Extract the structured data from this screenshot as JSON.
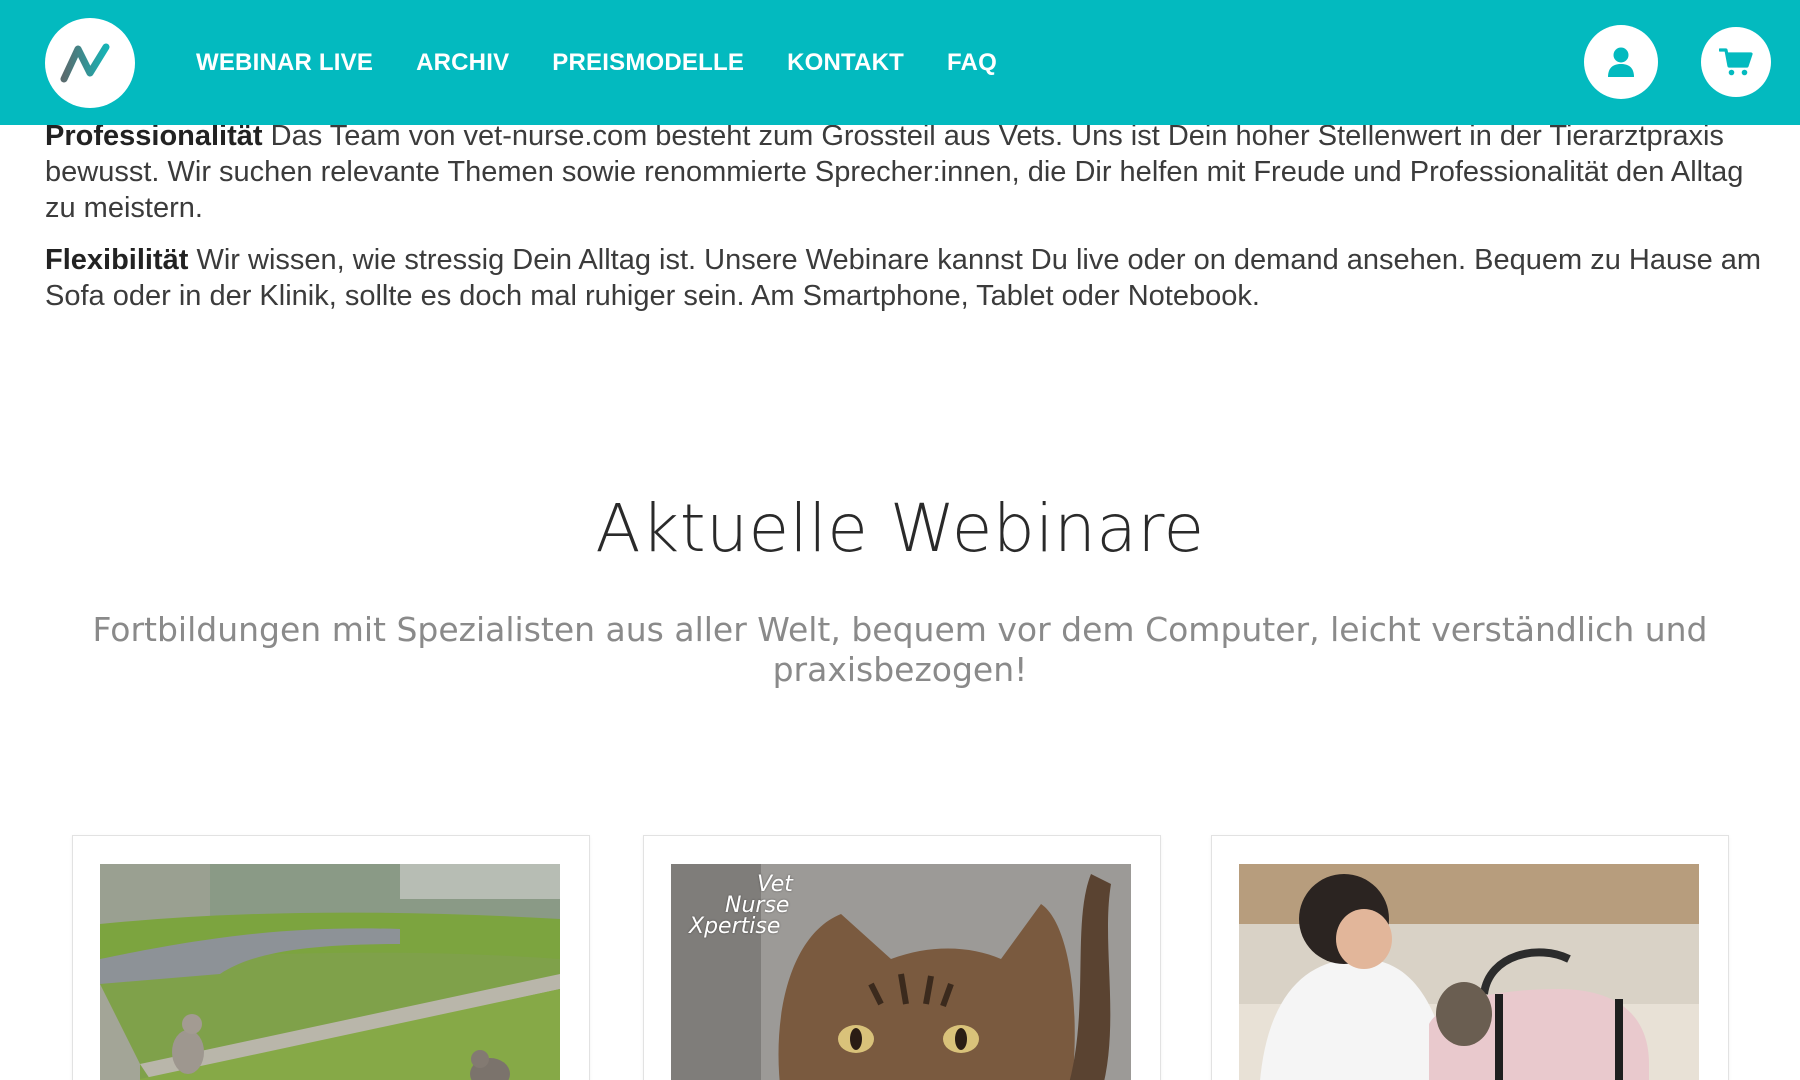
{
  "header": {
    "logo_icon": "vet-nurse-logo-icon",
    "nav": [
      {
        "label": "WEBINAR LIVE"
      },
      {
        "label": "ARCHIV"
      },
      {
        "label": "PREISMODELLE"
      },
      {
        "label": "KONTAKT"
      },
      {
        "label": "FAQ"
      }
    ],
    "user_icon": "user-icon",
    "cart_icon": "cart-icon",
    "accent_color": "#03babf"
  },
  "intro": {
    "p1_bold": "Professionalität",
    "p1_text": " Das Team von vet-nurse.com besteht zum Grossteil aus Vets. Uns ist Dein hoher Stellenwert in der Tierarztpraxis bewusst. Wir suchen relevante Themen sowie renommierte Sprecher:innen, die Dir helfen mit Freude und Professionalität den Alltag zu meistern.",
    "p2_bold": "Flexibilität",
    "p2_text": " Wir wissen, wie stressig Dein Alltag ist. Unsere Webinare kannst Du live oder on demand ansehen. Bequem zu Hause am Sofa oder in der Klinik, sollte es doch mal ruhiger sein. Am Smartphone, Tablet oder Notebook."
  },
  "section": {
    "title": "Aktuelle Webinare",
    "subtitle": "Fortbildungen mit Spezialisten aus aller Welt, bequem vor dem Computer, leicht verständlich und praxisbezogen!"
  },
  "cards": [
    {
      "image": "cats-in-garden-photo"
    },
    {
      "image": "tabby-cat-photo",
      "watermark": [
        "Vet",
        "Nurse",
        "Xpertise"
      ]
    },
    {
      "image": "vet-with-cat-carrier-photo"
    }
  ]
}
